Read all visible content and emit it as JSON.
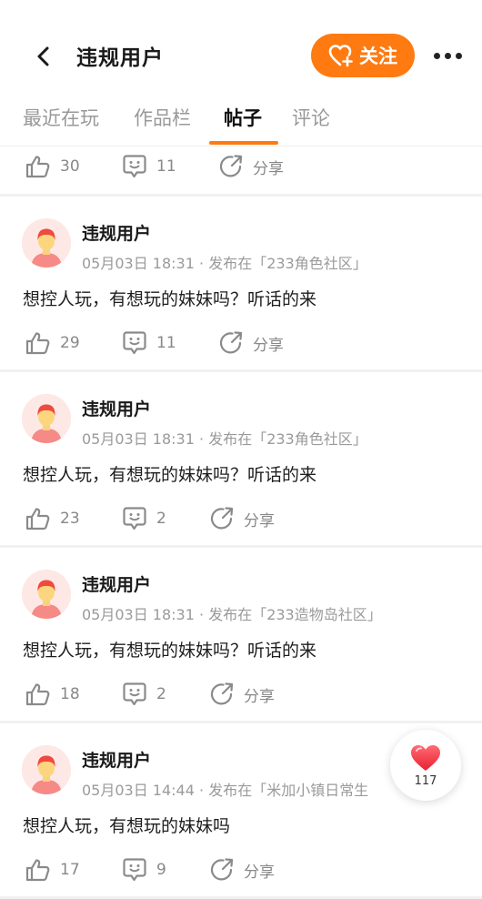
{
  "header": {
    "title": "违规用户",
    "follow_label": "关注"
  },
  "tabs": [
    "最近在玩",
    "作品栏",
    "帖子",
    "评论"
  ],
  "active_tab": "帖子",
  "top_actions": {
    "likes": "30",
    "comments": "11",
    "share": "分享"
  },
  "posts": [
    {
      "author": "违规用户",
      "time": "05月03日 18:31",
      "venue": "发布在「233角色社区」",
      "content": "想控人玩，有想玩的妹妹吗？听话的来",
      "likes": "29",
      "comments": "11",
      "share": "分享"
    },
    {
      "author": "违规用户",
      "time": "05月03日 18:31",
      "venue": "发布在「233角色社区」",
      "content": "想控人玩，有想玩的妹妹吗？听话的来",
      "likes": "23",
      "comments": "2",
      "share": "分享"
    },
    {
      "author": "违规用户",
      "time": "05月03日 18:31",
      "venue": "发布在「233造物岛社区」",
      "content": "想控人玩，有想玩的妹妹吗？听话的来",
      "likes": "18",
      "comments": "2",
      "share": "分享"
    },
    {
      "author": "违规用户",
      "time": "05月03日 14:44",
      "venue": "发布在「米加小镇日常生",
      "content": "想控人玩，有想玩的妹妹吗",
      "likes": "17",
      "comments": "9",
      "share": "分享"
    }
  ],
  "float_like": {
    "count": "117"
  },
  "colors": {
    "accent": "#ff7a10",
    "muted": "#999999",
    "heart": "#f23b4a"
  }
}
